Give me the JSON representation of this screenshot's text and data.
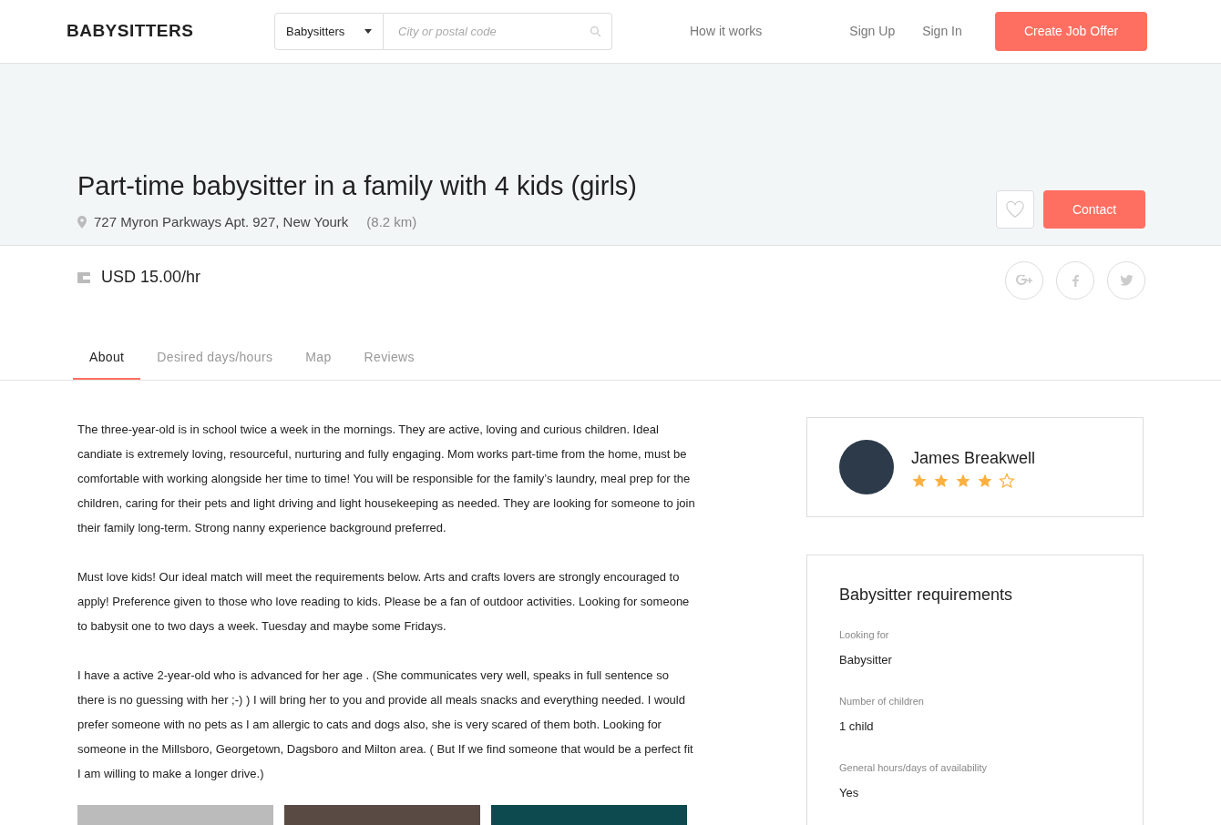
{
  "header": {
    "logo": "BABYSITTERS",
    "category": "Babysitters",
    "search_placeholder": "City or postal code",
    "nav": [
      "How it works",
      "Sign Up",
      "Sign In"
    ],
    "cta": "Create Job Offer"
  },
  "job": {
    "title": "Part-time babysitter in a family with 4 kids (girls)",
    "address": "727 Myron Parkways Apt. 927, New Yourk",
    "distance": "(8.2 km)",
    "favorite": false,
    "contact": "Contact",
    "price": "USD 15.00/hr"
  },
  "tabs": [
    {
      "label": "About",
      "selected": true
    },
    {
      "label": "Desired days/hours",
      "selected": false
    },
    {
      "label": "Map",
      "selected": false
    },
    {
      "label": "Reviews",
      "selected": false
    }
  ],
  "about": [
    "The three-year-old is in school twice a week in the mornings. They are active, loving and curious children. Ideal candiate is extremely loving, resourceful, nurturing and fully engaging. Mom works part-time from the home, must be comfortable with working alongside her time to time! You will be responsible for the family’s laundry, meal prep for the children, caring for their pets and light driving and light housekeeping as needed. They are looking for someone to join their family long-term. Strong nanny experience background preferred.",
    "Must love kids! Our ideal match will meet the requirements below. Arts and crafts lovers are strongly encouraged to apply! Preference given to those who love reading to kids. Please be a fan of outdoor activities. Looking for someone to babysit one to two days a week. Tuesday and maybe some Fridays.",
    "I have a active 2-year-old who is advanced for her age . (She communicates very well, speaks in full sentence so there is no guessing with her ;-) ) I will bring her to you and provide all meals snacks and everything needed. I would prefer someone with no pets as I am allergic to cats and dogs also, she is very scared of them both. Looking for someone in the Millsboro, Georgetown, Dagsboro and Milton area. ( But If we find someone that would be a perfect fit I am willing to make a longer drive.)"
  ],
  "author": {
    "name": "James Breakwell",
    "stars": 4
  },
  "requirements": {
    "title": "Babysitter requirements",
    "items": [
      {
        "label": "Looking for",
        "value": "Babysitter"
      },
      {
        "label": "Number of children",
        "value": "1 child"
      },
      {
        "label": "General hours/days of availability",
        "value": "Yes"
      }
    ]
  }
}
